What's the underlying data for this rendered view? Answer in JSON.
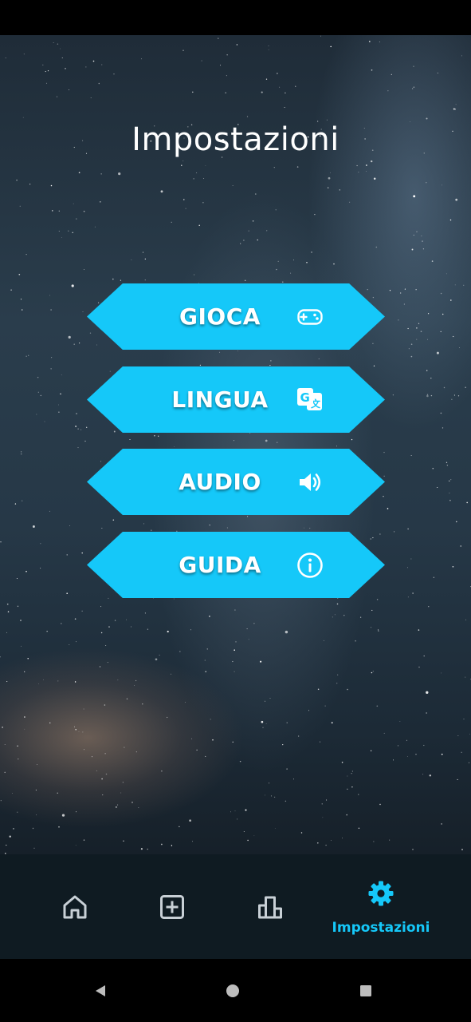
{
  "screen": {
    "title": "Impostazioni"
  },
  "menu": [
    {
      "label": "GIOCA",
      "icon": "gamepad-icon"
    },
    {
      "label": "LINGUA",
      "icon": "translate-icon"
    },
    {
      "label": "AUDIO",
      "icon": "volume-icon"
    },
    {
      "label": "GUIDA",
      "icon": "info-icon"
    }
  ],
  "bottom_nav": {
    "items": [
      {
        "icon": "home-icon",
        "label": "",
        "active": false
      },
      {
        "icon": "add-box-icon",
        "label": "",
        "active": false
      },
      {
        "icon": "leaderboard-icon",
        "label": "",
        "active": false
      },
      {
        "icon": "gear-icon",
        "label": "Impostazioni",
        "active": true
      }
    ]
  },
  "colors": {
    "accent": "#15c8f9",
    "nav_background": "#0f1b22",
    "inactive_icon": "#c8d0d6",
    "text": "#ffffff"
  }
}
